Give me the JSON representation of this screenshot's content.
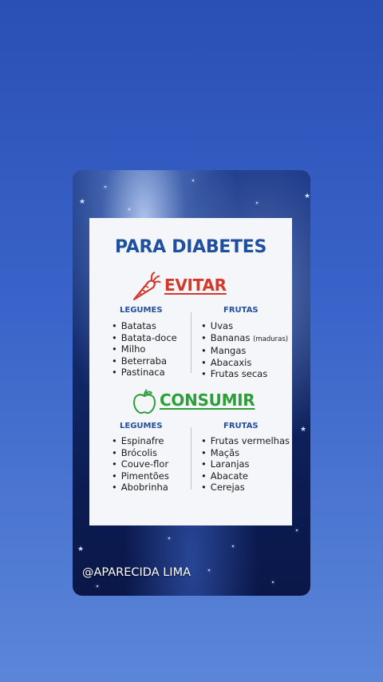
{
  "card": {
    "title": "PARA DIABETES",
    "avoid": {
      "label": "EVITAR",
      "icon": "carrot-icon",
      "color": "#d3392b",
      "columns": [
        {
          "heading": "LEGUMES",
          "items": [
            {
              "text": "Batatas"
            },
            {
              "text": "Batata-doce"
            },
            {
              "text": "Milho"
            },
            {
              "text": "Beterraba"
            },
            {
              "text": "Pastinaca"
            }
          ]
        },
        {
          "heading": "FRUTAS",
          "items": [
            {
              "text": "Uvas"
            },
            {
              "text": "Bananas",
              "note": "(maduras)"
            },
            {
              "text": "Mangas"
            },
            {
              "text": "Abacaxis"
            },
            {
              "text": "Frutas secas"
            }
          ]
        }
      ]
    },
    "consume": {
      "label": "CONSUMIR",
      "icon": "apple-icon",
      "color": "#2e9e3a",
      "columns": [
        {
          "heading": "LEGUMES",
          "items": [
            {
              "text": "Espinafre"
            },
            {
              "text": "Brócolis"
            },
            {
              "text": "Couve-flor"
            },
            {
              "text": "Pimentões"
            },
            {
              "text": "Abobrinha"
            }
          ]
        },
        {
          "heading": "FRUTAS",
          "items": [
            {
              "text": "Frutas vermelhas"
            },
            {
              "text": "Maçãs"
            },
            {
              "text": "Laranjas"
            },
            {
              "text": "Abacate"
            },
            {
              "text": "Cerejas"
            }
          ]
        }
      ]
    }
  },
  "watermark": "@APARECIDA LIMA",
  "colors": {
    "background": "#3a64c9",
    "title": "#1f4f9f",
    "panel": "#f4f6f9"
  }
}
